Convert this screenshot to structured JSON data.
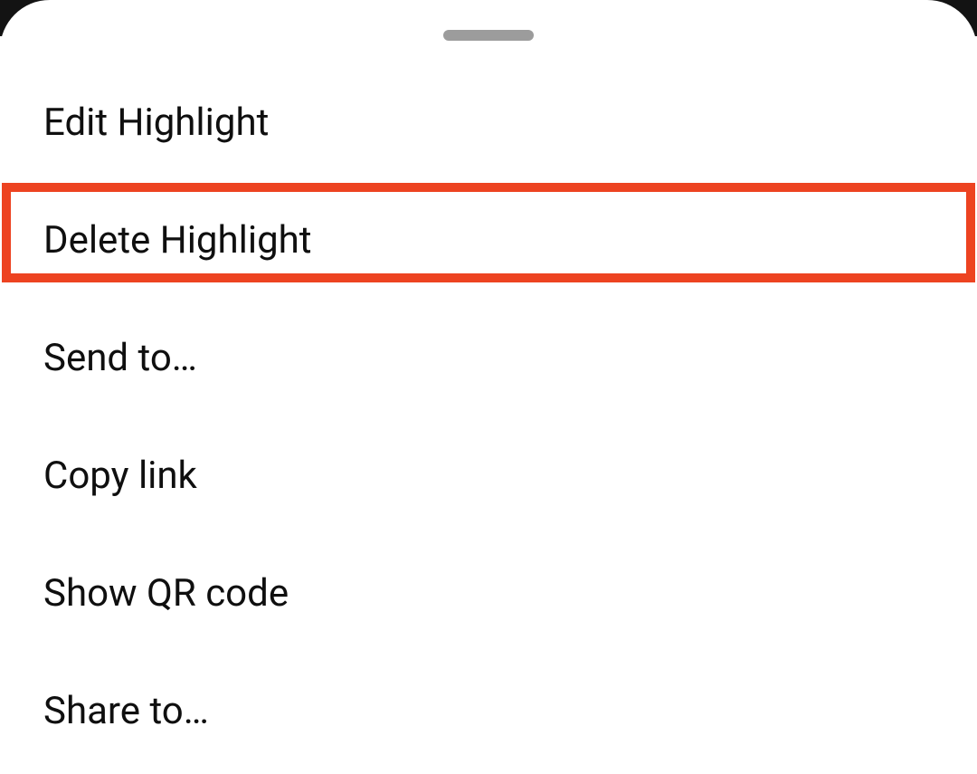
{
  "menu": {
    "items": [
      {
        "label": "Edit Highlight",
        "highlighted": false
      },
      {
        "label": "Delete Highlight",
        "highlighted": true
      },
      {
        "label": "Send to…",
        "highlighted": false
      },
      {
        "label": "Copy link",
        "highlighted": false
      },
      {
        "label": "Show QR code",
        "highlighted": false
      },
      {
        "label": "Share to…",
        "highlighted": false
      }
    ]
  },
  "annotation": {
    "highlight_color": "#ed4321"
  }
}
